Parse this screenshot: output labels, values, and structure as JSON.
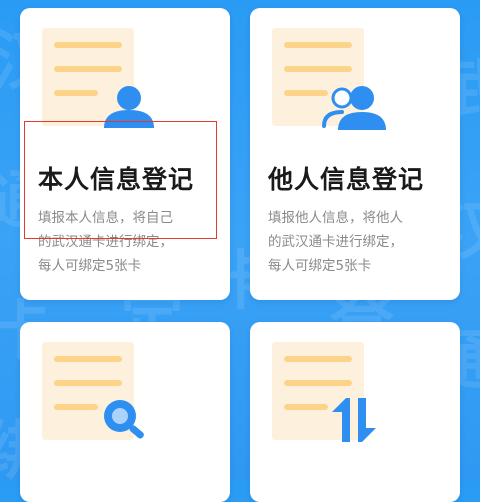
{
  "cards": [
    {
      "title": "本人信息登记",
      "desc_lines": [
        "填报本人信息，将自己",
        "的武汉通卡进行绑定，",
        "每人可绑定5张卡"
      ],
      "icon": "single-person-icon"
    },
    {
      "title": "他人信息登记",
      "desc_lines": [
        "填报他人信息，将他人",
        "的武汉通卡进行绑定，",
        "每人可绑定5张卡"
      ],
      "icon": "two-persons-icon"
    },
    {
      "title": "",
      "desc_lines": [],
      "icon": "magnifier-icon"
    },
    {
      "title": "",
      "desc_lines": [],
      "icon": "swap-arrows-icon"
    }
  ],
  "colors": {
    "background": "#2a9bf4",
    "card": "#ffffff",
    "accent_blue": "#2f8ff0",
    "doc_paper": "#fdf1de",
    "doc_line": "#fbd489",
    "highlight": "#e23b2e"
  }
}
